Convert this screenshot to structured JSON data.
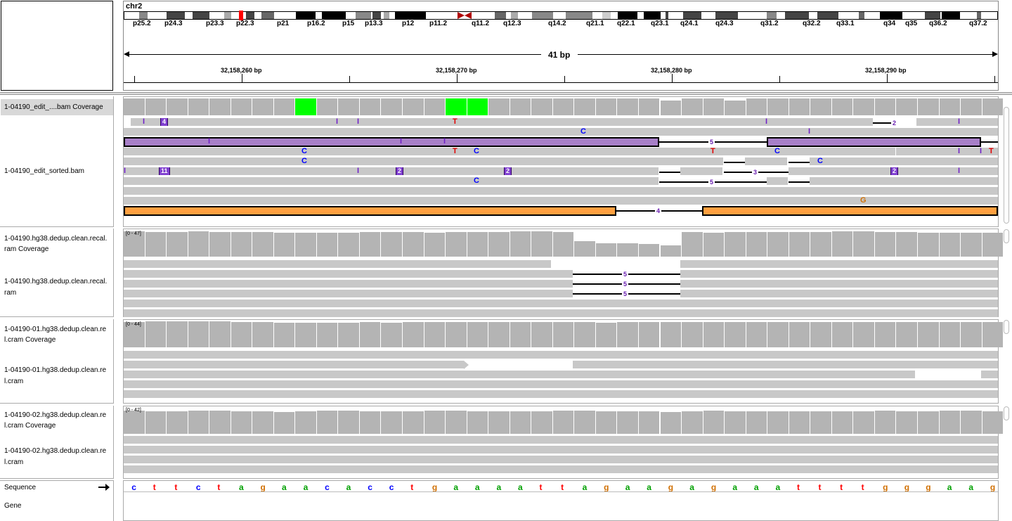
{
  "ideogram": {
    "chromosome": "chr2",
    "bands": [
      "p25.2",
      "p24.3",
      "p23.3",
      "p22.3",
      "p21",
      "p16.2",
      "p15",
      "p13.3",
      "p12",
      "p11.2",
      "q11.2",
      "q12.3",
      "q14.2",
      "q21.1",
      "q22.1",
      "q23.1",
      "q24.1",
      "q24.3",
      "q31.2",
      "q32.2",
      "q33.1",
      "q34",
      "q35",
      "q36.2",
      "q37.2"
    ]
  },
  "ruler": {
    "span": "41 bp",
    "ticks": [
      "32,158,260 bp",
      "32,158,270 bp",
      "32,158,280 bp",
      "32,158,290 bp"
    ]
  },
  "tracks": {
    "t1_cov": "1-04190_edit_....bam Coverage",
    "t1_aln": "1-04190_edit_sorted.bam",
    "t2_cov_l1": "1-04190.hg38.dedup.clean.recal.",
    "t2_cov_l2": "ram Coverage",
    "t2_aln_l1": "1-04190.hg38.dedup.clean.recal.",
    "t2_aln_l2": "ram",
    "t2_range": "[0 - 47]",
    "t3_cov_l1": "1-04190-01.hg38.dedup.clean.re",
    "t3_cov_l2": "l.cram Coverage",
    "t3_aln_l1": "1-04190-01.hg38.dedup.clean.re",
    "t3_aln_l2": "l.cram",
    "t3_range": "[0 - 44]",
    "t4_cov_l1": "1-04190-02.hg38.dedup.clean.re",
    "t4_cov_l2": "l.cram Coverage",
    "t4_aln_l1": "1-04190-02.hg38.dedup.clean.re",
    "t4_aln_l2": "l.cram",
    "t4_range": "[0 - 42]",
    "sequence": "Sequence",
    "gene": "Gene"
  },
  "marks": {
    "ins": "I",
    "ins4": "4",
    "ins11": "11",
    "ins2": "2",
    "gap2": "2",
    "gap3": "3",
    "gap4": "4",
    "gap5": "5",
    "T": "T",
    "C": "C",
    "G": "G"
  },
  "sequence": [
    "c",
    "t",
    "t",
    "c",
    "t",
    "a",
    "g",
    "a",
    "a",
    "c",
    "a",
    "c",
    "c",
    "t",
    "g",
    "a",
    "a",
    "a",
    "a",
    "t",
    "t",
    "a",
    "g",
    "a",
    "a",
    "g",
    "a",
    "g",
    "a",
    "a",
    "a",
    "t",
    "t",
    "t",
    "t",
    "g",
    "g",
    "g",
    "a",
    "a",
    "g"
  ],
  "base_colors": {
    "a": "#00a000",
    "c": "#0000ff",
    "g": "#d17105",
    "t": "#ff0000"
  },
  "icons": {
    "strand": "arrow-right-icon"
  }
}
